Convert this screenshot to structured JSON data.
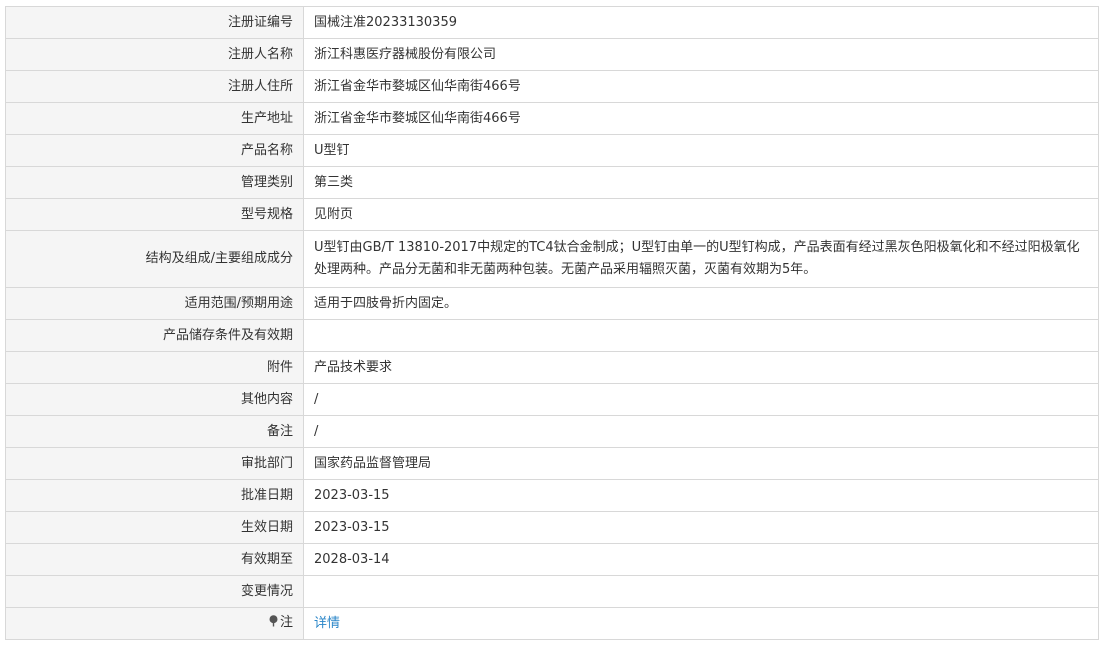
{
  "rows": [
    {
      "label": "注册证编号",
      "value": "国械注准20233130359"
    },
    {
      "label": "注册人名称",
      "value": "浙江科惠医疗器械股份有限公司"
    },
    {
      "label": "注册人住所",
      "value": "浙江省金华市婺城区仙华南街466号"
    },
    {
      "label": "生产地址",
      "value": "浙江省金华市婺城区仙华南街466号"
    },
    {
      "label": "产品名称",
      "value": "U型钉"
    },
    {
      "label": "管理类别",
      "value": "第三类"
    },
    {
      "label": "型号规格",
      "value": "见附页"
    },
    {
      "label": "结构及组成/主要组成成分",
      "value": "U型钉由GB/T 13810-2017中规定的TC4钛合金制成；U型钉由单一的U型钉构成，产品表面有经过黑灰色阳极氧化和不经过阳极氧化处理两种。产品分无菌和非无菌两种包装。无菌产品采用辐照灭菌，灭菌有效期为5年。"
    },
    {
      "label": "适用范围/预期用途",
      "value": "适用于四肢骨折内固定。"
    },
    {
      "label": "产品储存条件及有效期",
      "value": ""
    },
    {
      "label": "附件",
      "value": "产品技术要求"
    },
    {
      "label": "其他内容",
      "value": "/"
    },
    {
      "label": "备注",
      "value": "/"
    },
    {
      "label": "审批部门",
      "value": "国家药品监督管理局"
    },
    {
      "label": "批准日期",
      "value": "2023-03-15"
    },
    {
      "label": "生效日期",
      "value": "2023-03-15"
    },
    {
      "label": "有效期至",
      "value": "2028-03-14"
    },
    {
      "label": "变更情况",
      "value": ""
    }
  ],
  "note": {
    "icon": "pin-icon",
    "label": "注",
    "link_text": "详情",
    "link_color": "#2a86c8"
  }
}
